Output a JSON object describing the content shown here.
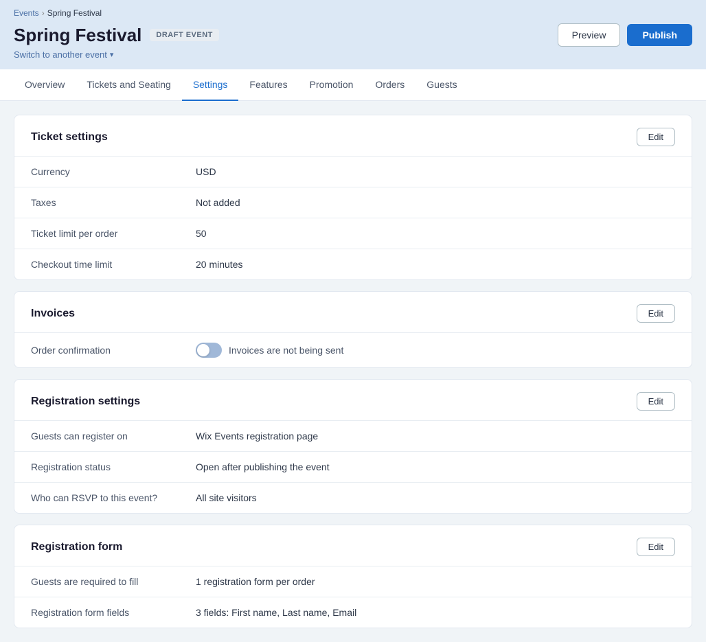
{
  "breadcrumb": {
    "parent_label": "Events",
    "current_label": "Spring Festival"
  },
  "header": {
    "title": "Spring Festival",
    "draft_badge": "DRAFT EVENT",
    "switch_event_label": "Switch to another event",
    "preview_label": "Preview",
    "publish_label": "Publish"
  },
  "nav": {
    "tabs": [
      {
        "id": "overview",
        "label": "Overview",
        "active": false
      },
      {
        "id": "tickets-and-seating",
        "label": "Tickets and Seating",
        "active": false
      },
      {
        "id": "settings",
        "label": "Settings",
        "active": true
      },
      {
        "id": "features",
        "label": "Features",
        "active": false
      },
      {
        "id": "promotion",
        "label": "Promotion",
        "active": false
      },
      {
        "id": "orders",
        "label": "Orders",
        "active": false
      },
      {
        "id": "guests",
        "label": "Guests",
        "active": false
      }
    ]
  },
  "ticket_settings": {
    "title": "Ticket settings",
    "edit_label": "Edit",
    "rows": [
      {
        "label": "Currency",
        "value": "USD"
      },
      {
        "label": "Taxes",
        "value": "Not added"
      },
      {
        "label": "Ticket limit per order",
        "value": "50"
      },
      {
        "label": "Checkout time limit",
        "value": "20 minutes"
      }
    ]
  },
  "invoices": {
    "title": "Invoices",
    "edit_label": "Edit",
    "rows": [
      {
        "label": "Order confirmation",
        "toggle": true,
        "toggle_enabled": false,
        "value": "Invoices are not being sent"
      }
    ]
  },
  "registration_settings": {
    "title": "Registration settings",
    "edit_label": "Edit",
    "rows": [
      {
        "label": "Guests can register on",
        "value": "Wix Events registration page"
      },
      {
        "label": "Registration status",
        "value": "Open after publishing the event"
      },
      {
        "label": "Who can RSVP to this event?",
        "value": "All site visitors"
      }
    ]
  },
  "registration_form": {
    "title": "Registration form",
    "edit_label": "Edit",
    "rows": [
      {
        "label": "Guests are required to fill",
        "value": "1 registration form per order"
      },
      {
        "label": "Registration form fields",
        "value": "3 fields: First name, Last name, Email"
      }
    ]
  }
}
